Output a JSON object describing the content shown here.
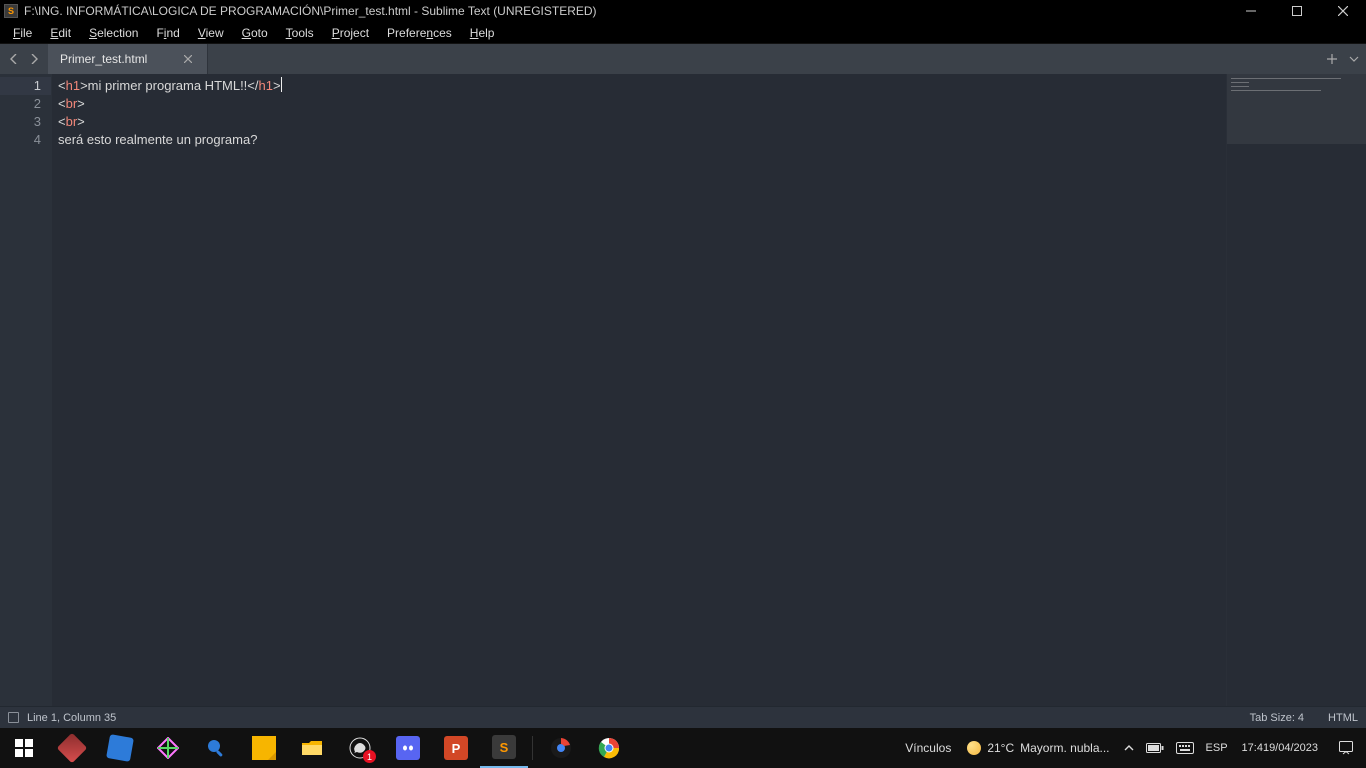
{
  "titlebar": {
    "title": "F:\\ING. INFORMÁTICA\\LOGICA DE PROGRAMACIÓN\\Primer_test.html - Sublime Text (UNREGISTERED)"
  },
  "menu": {
    "file": {
      "underline": "F",
      "rest": "ile"
    },
    "edit": {
      "underline": "E",
      "rest": "dit"
    },
    "selection": {
      "underline": "S",
      "rest": "election"
    },
    "find": {
      "pre": "F",
      "underline": "i",
      "post": "nd"
    },
    "view": {
      "underline": "V",
      "rest": "iew"
    },
    "goto": {
      "underline": "G",
      "rest": "oto"
    },
    "tools": {
      "underline": "T",
      "rest": "ools"
    },
    "project": {
      "underline": "P",
      "rest": "roject"
    },
    "preferences": {
      "pre": "Prefere",
      "underline": "n",
      "post": "ces"
    },
    "help": {
      "underline": "H",
      "rest": "elp"
    }
  },
  "tabs": {
    "items": [
      {
        "label": "Primer_test.html"
      }
    ]
  },
  "editor": {
    "line_numbers": [
      "1",
      "2",
      "3",
      "4"
    ],
    "l1": {
      "open_br": "<",
      "open_tag": "h1",
      "open_end": ">",
      "text": "mi primer programa HTML!!",
      "close_br": "</",
      "close_tag": "h1",
      "close_end": ">"
    },
    "l2": {
      "open_br": "<",
      "tag": "br",
      "close": ">"
    },
    "l3": {
      "open_br": "<",
      "tag": "br",
      "close": ">"
    },
    "l4": {
      "text": "será esto realmente un programa?"
    }
  },
  "statusbar": {
    "position": "Line 1, Column 35",
    "tabsize": "Tab Size: 4",
    "syntax": "HTML"
  },
  "taskbar": {
    "links_label": "Vínculos",
    "temp": "21°C",
    "weather": "Mayorm. nubla...",
    "lang": "ESP",
    "time": "17:41",
    "date": "9/04/2023"
  }
}
